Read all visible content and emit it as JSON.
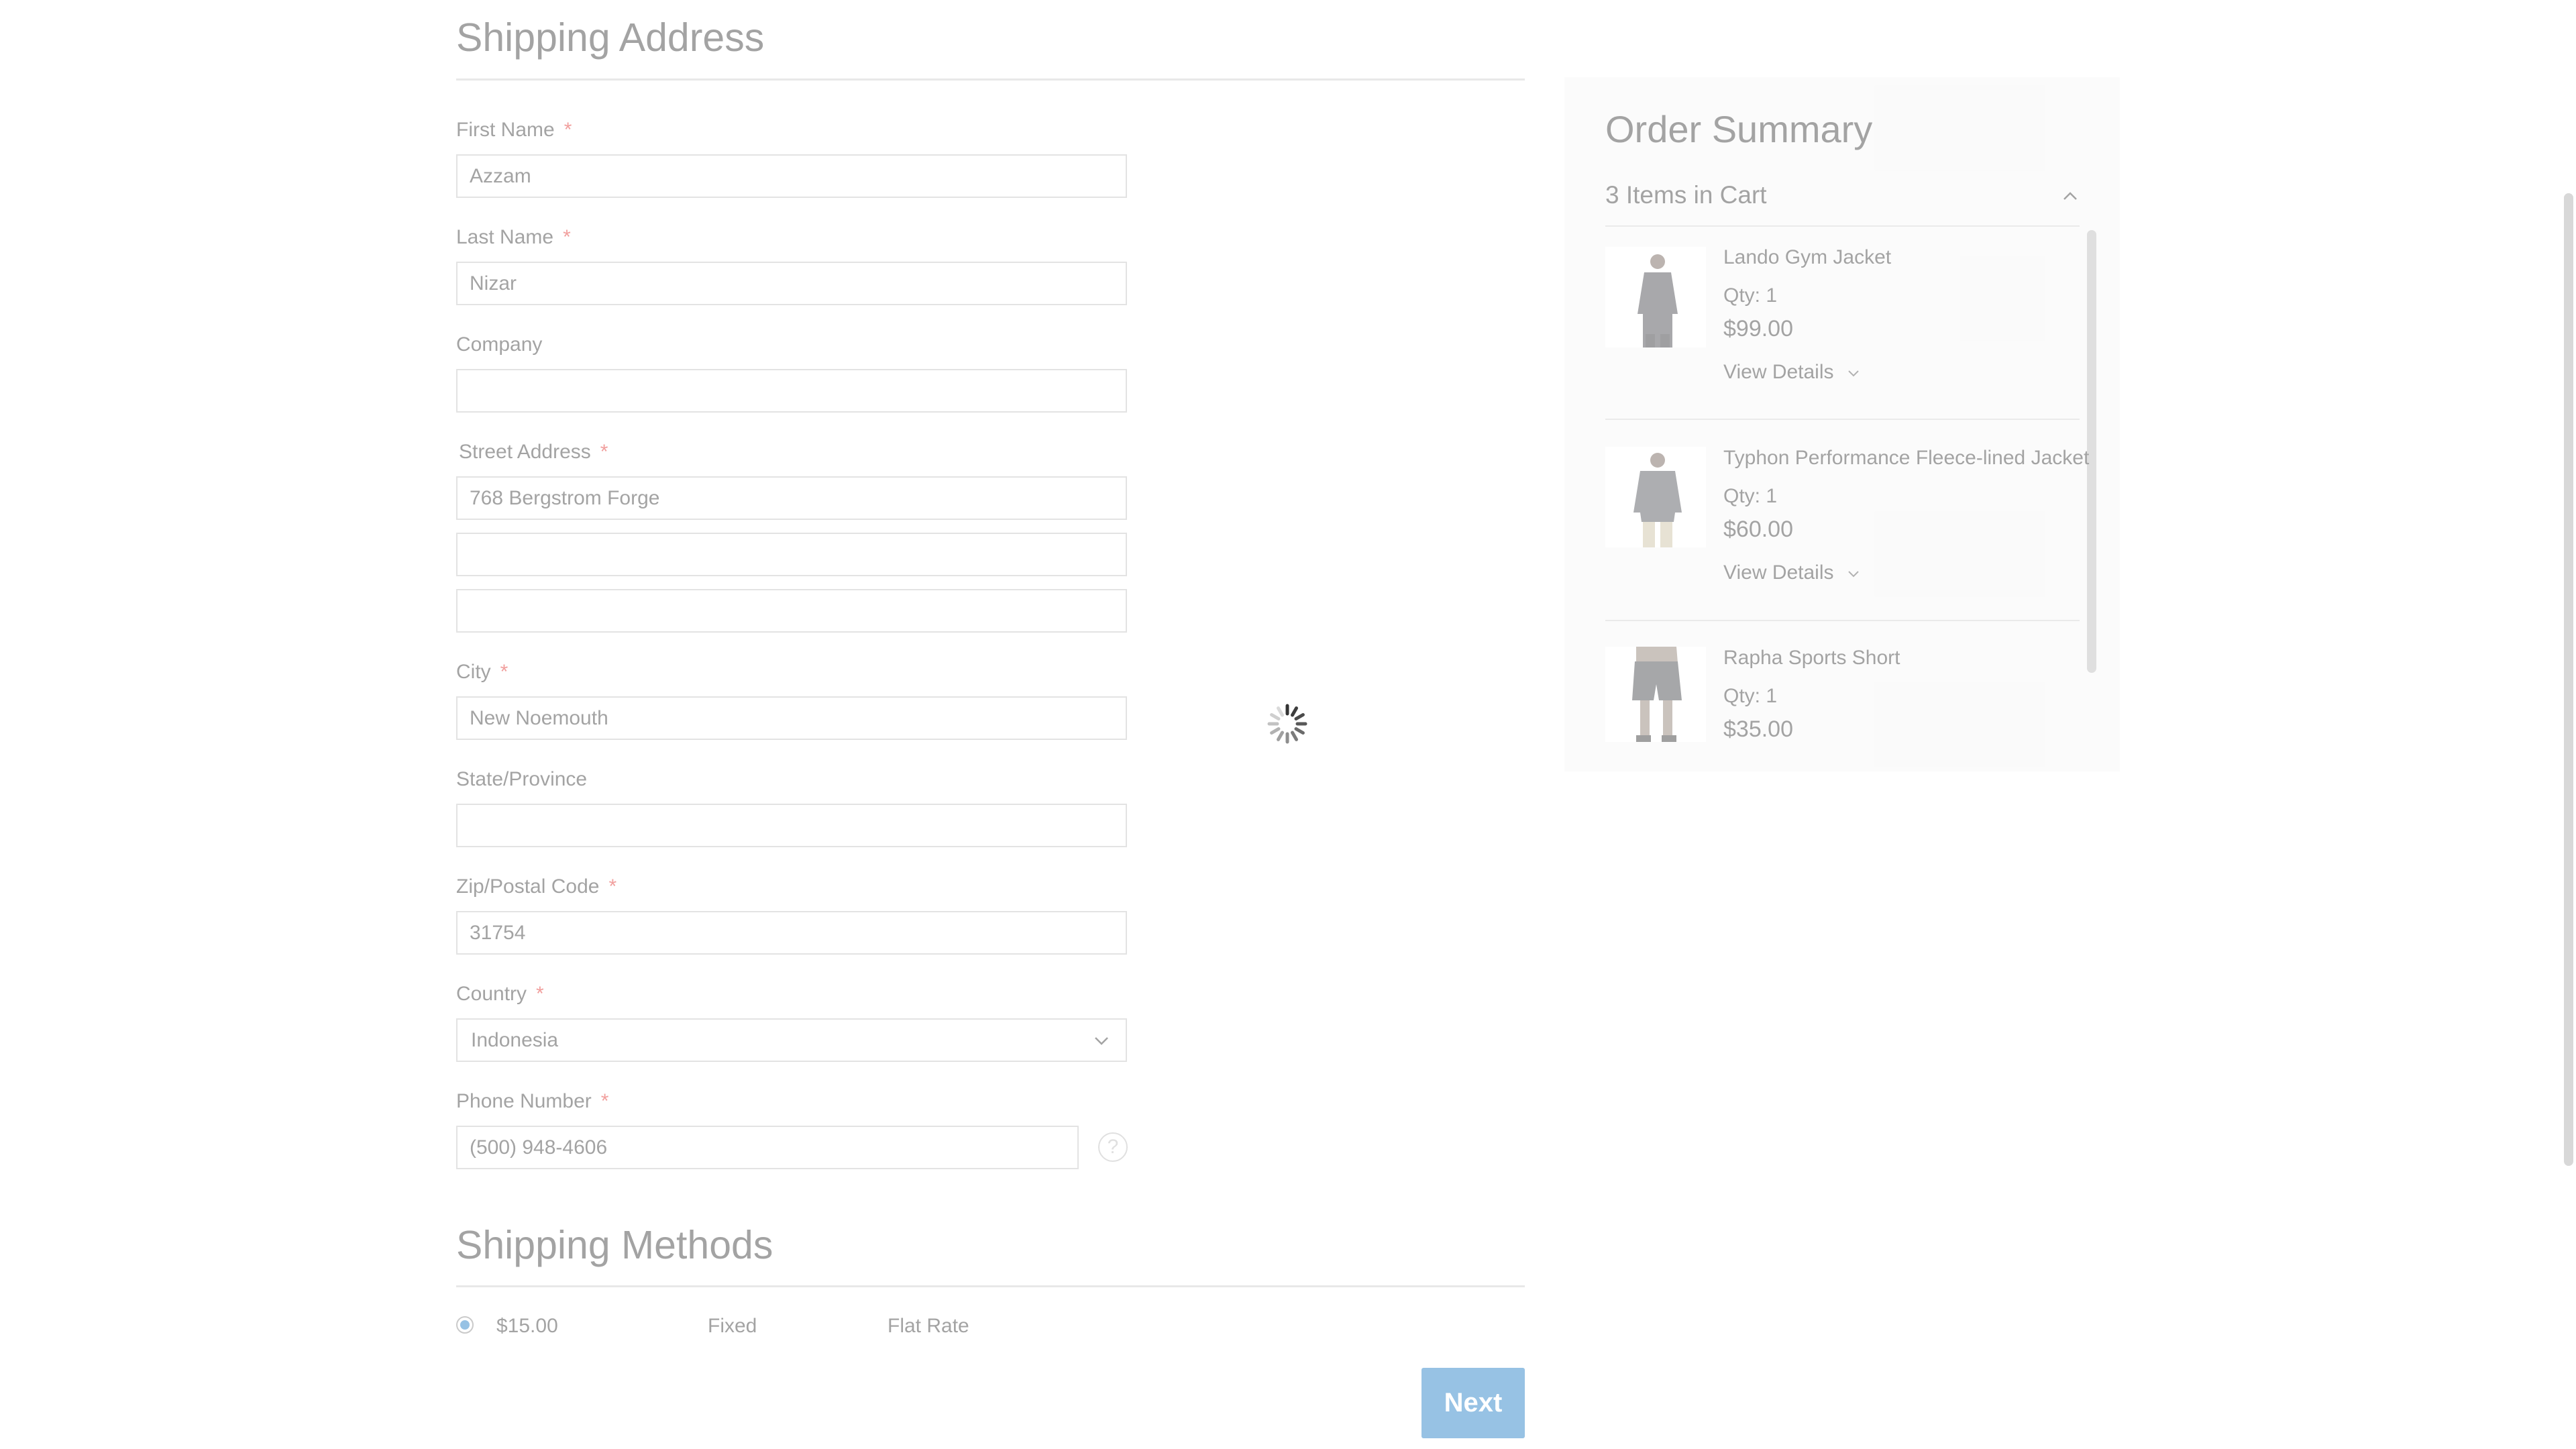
{
  "shipping_address": {
    "title": "Shipping Address",
    "fields": {
      "first_name": {
        "label": "First Name",
        "required_mark": "*",
        "value": "Azzam"
      },
      "last_name": {
        "label": "Last Name",
        "required_mark": "*",
        "value": "Nizar"
      },
      "company": {
        "label": "Company",
        "value": ""
      },
      "street": {
        "label": "Street Address",
        "required_mark": "*",
        "line1": "768 Bergstrom Forge",
        "line2": "",
        "line3": ""
      },
      "city": {
        "label": "City",
        "required_mark": "*",
        "value": "New Noemouth"
      },
      "state": {
        "label": "State/Province",
        "value": ""
      },
      "zip": {
        "label": "Zip/Postal Code",
        "required_mark": "*",
        "value": "31754"
      },
      "country": {
        "label": "Country",
        "required_mark": "*",
        "value": "Indonesia"
      },
      "phone": {
        "label": "Phone Number",
        "required_mark": "*",
        "value": "(500) 948-4606",
        "help_glyph": "?"
      }
    }
  },
  "shipping_methods": {
    "title": "Shipping Methods",
    "options": [
      {
        "price": "$15.00",
        "method": "Fixed",
        "carrier": "Flat Rate",
        "selected": true
      }
    ],
    "next_label": "Next"
  },
  "order_summary": {
    "title": "Order Summary",
    "items_count_label": "3 Items in Cart",
    "items": [
      {
        "name": "Lando Gym Jacket",
        "qty": "Qty: 1",
        "price": "$99.00",
        "details_label": "View Details"
      },
      {
        "name": "Typhon Performance Fleece-lined Jacket",
        "qty": "Qty: 1",
        "price": "$60.00",
        "details_label": "View Details"
      },
      {
        "name": "Rapha Sports Short",
        "qty": "Qty: 1",
        "price": "$35.00"
      }
    ]
  },
  "colors": {
    "accent": "#1979c3",
    "required": "#e02b27",
    "summary_bg": "#f5f5f5"
  },
  "icons": [
    "chevron-down-icon",
    "chevron-up-icon",
    "help-icon",
    "loading-spinner-icon",
    "radio-selected-icon"
  ]
}
